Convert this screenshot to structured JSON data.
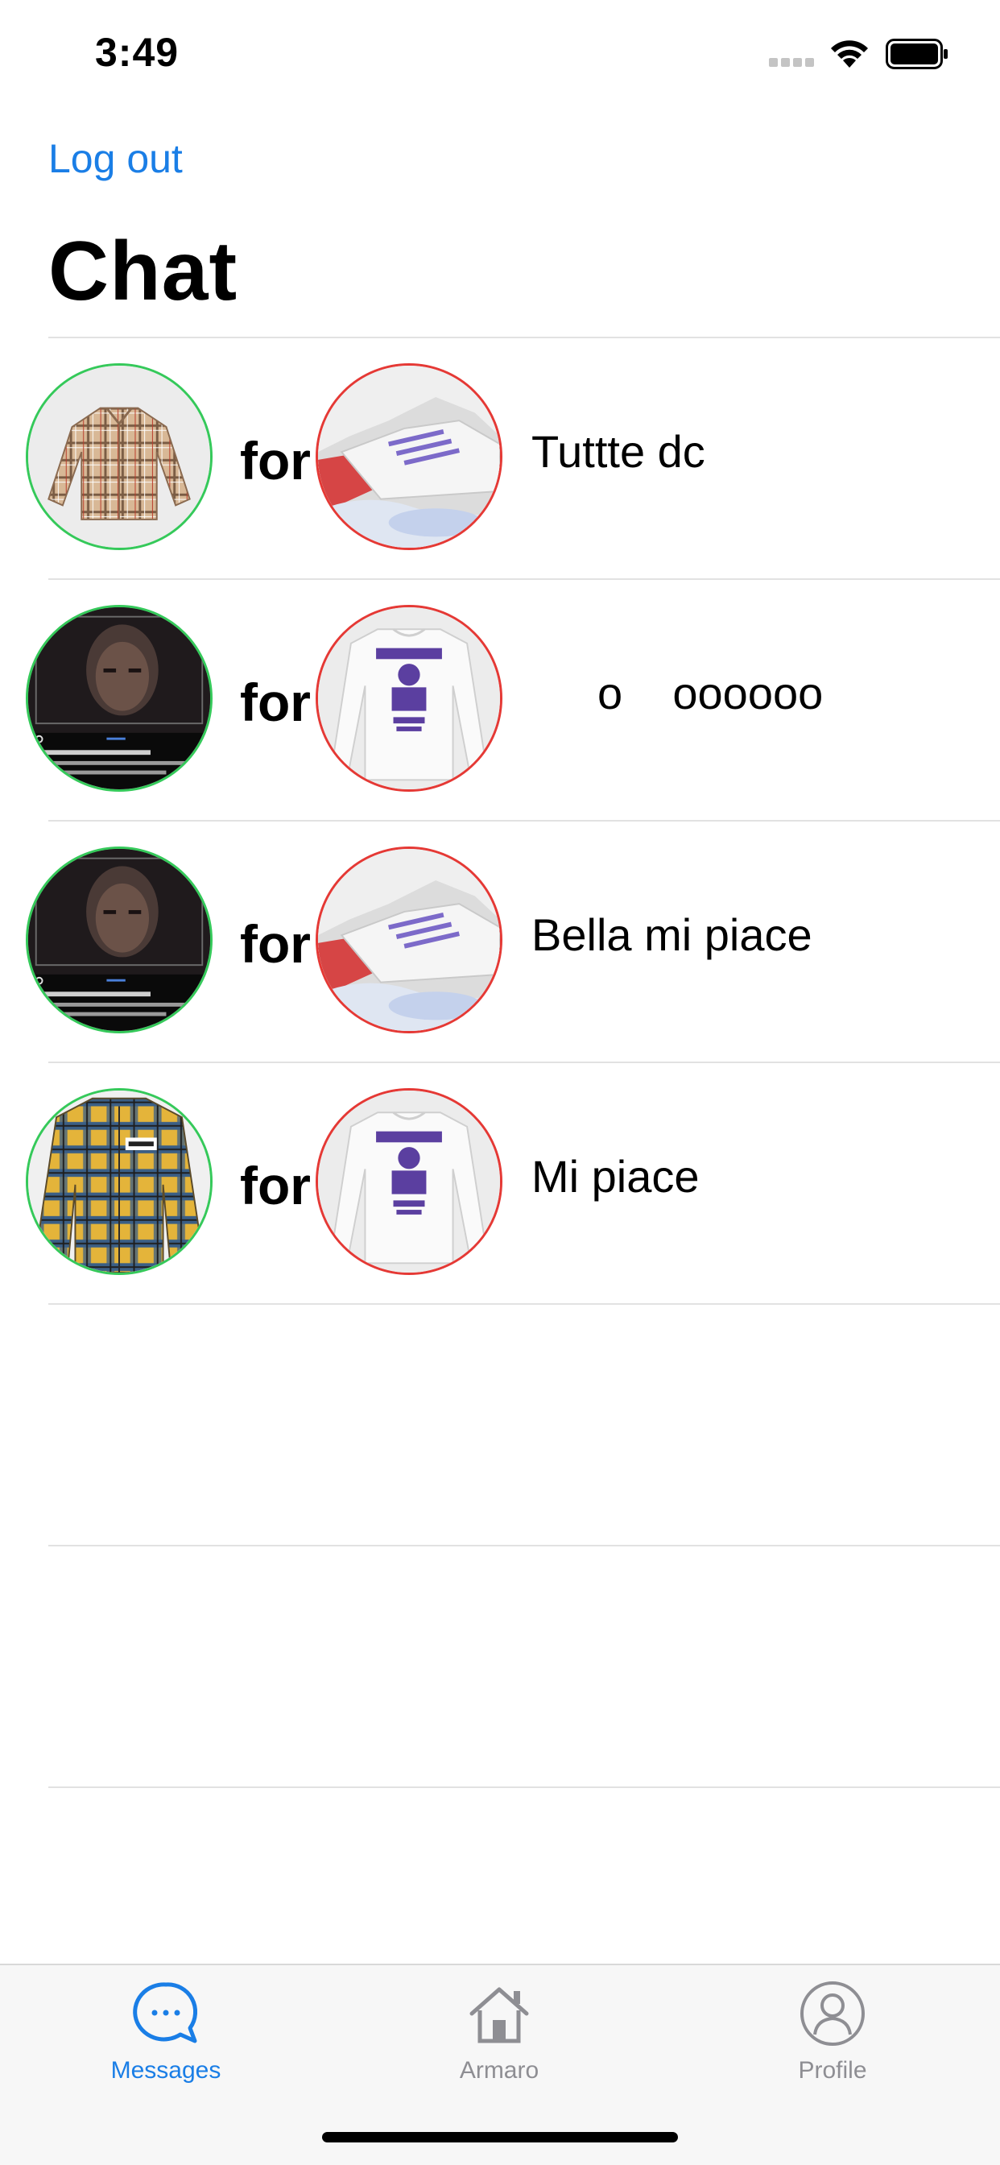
{
  "status_bar": {
    "time": "3:49"
  },
  "nav": {
    "logout_label": "Log out",
    "title": "Chat"
  },
  "chats": [
    {
      "left_item": "plaid-shirt",
      "for_label": "for",
      "right_item": "sneaker",
      "message": "Tuttte dc"
    },
    {
      "left_item": "portrait-post",
      "for_label": "for",
      "right_item": "lebron-longsleeve",
      "message": "o    oooooo"
    },
    {
      "left_item": "portrait-post",
      "for_label": "for",
      "right_item": "sneaker",
      "message": "Bella mi piace"
    },
    {
      "left_item": "flannel-shirt",
      "for_label": "for",
      "right_item": "lebron-longsleeve",
      "message": "Mi piace"
    }
  ],
  "tabs": [
    {
      "label": "Messages",
      "icon": "chat-bubble-icon",
      "active": true
    },
    {
      "label": "Armaro",
      "icon": "house-icon",
      "active": false
    },
    {
      "label": "Profile",
      "icon": "person-icon",
      "active": false
    }
  ],
  "colors": {
    "accent": "#1a7ee6",
    "offered_border": "#35c95a",
    "requested_border": "#e53935",
    "inactive_tab": "#8e8e93"
  }
}
